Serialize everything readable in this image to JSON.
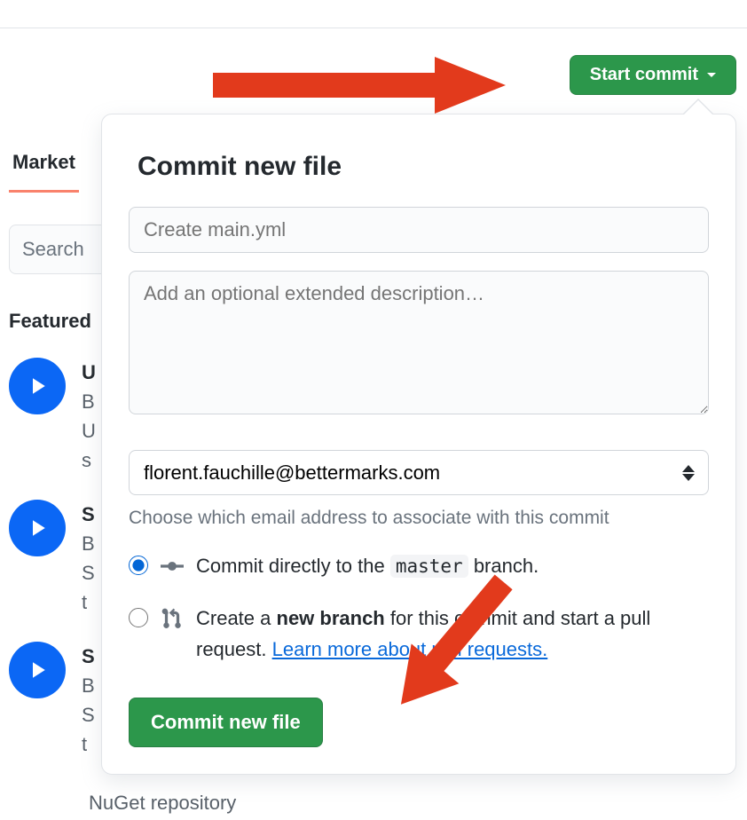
{
  "toolbar": {
    "start_commit_label": "Start commit"
  },
  "background": {
    "tab_label": "Market",
    "search_placeholder": "Search",
    "featured_heading": "Featured",
    "nuget_text": "NuGet repository",
    "items": [
      {
        "title": "U",
        "line2": "B",
        "line3": "U",
        "line4": "s"
      },
      {
        "title": "S",
        "line2": "B",
        "line3": "S",
        "line4": "t"
      },
      {
        "title": "S",
        "line2": "B",
        "line3": "S",
        "line4": "t"
      }
    ]
  },
  "popover": {
    "title": "Commit new file",
    "summary_placeholder": "Create main.yml",
    "description_placeholder": "Add an optional extended description…",
    "email_value": "florent.fauchille@bettermarks.com",
    "email_hint": "Choose which email address to associate with this commit",
    "radio1_prefix": "Commit directly to the ",
    "radio1_branch": "master",
    "radio1_suffix": " branch.",
    "radio2_prefix": "Create a ",
    "radio2_bold": "new branch",
    "radio2_mid": " for this commit and start a pull request. ",
    "radio2_link": "Learn more about pull requests.",
    "commit_button": "Commit new file"
  }
}
